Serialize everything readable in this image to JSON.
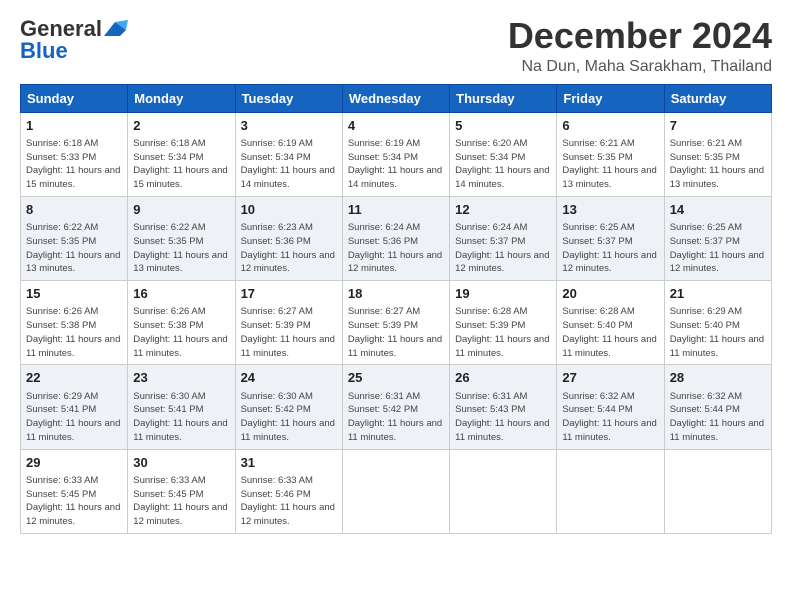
{
  "header": {
    "logo_general": "General",
    "logo_blue": "Blue",
    "month_title": "December 2024",
    "location": "Na Dun, Maha Sarakham, Thailand"
  },
  "weekdays": [
    "Sunday",
    "Monday",
    "Tuesday",
    "Wednesday",
    "Thursday",
    "Friday",
    "Saturday"
  ],
  "weeks": [
    [
      {
        "day": "1",
        "sunrise": "6:18 AM",
        "sunset": "5:33 PM",
        "daylight": "11 hours and 15 minutes."
      },
      {
        "day": "2",
        "sunrise": "6:18 AM",
        "sunset": "5:34 PM",
        "daylight": "11 hours and 15 minutes."
      },
      {
        "day": "3",
        "sunrise": "6:19 AM",
        "sunset": "5:34 PM",
        "daylight": "11 hours and 14 minutes."
      },
      {
        "day": "4",
        "sunrise": "6:19 AM",
        "sunset": "5:34 PM",
        "daylight": "11 hours and 14 minutes."
      },
      {
        "day": "5",
        "sunrise": "6:20 AM",
        "sunset": "5:34 PM",
        "daylight": "11 hours and 14 minutes."
      },
      {
        "day": "6",
        "sunrise": "6:21 AM",
        "sunset": "5:35 PM",
        "daylight": "11 hours and 13 minutes."
      },
      {
        "day": "7",
        "sunrise": "6:21 AM",
        "sunset": "5:35 PM",
        "daylight": "11 hours and 13 minutes."
      }
    ],
    [
      {
        "day": "8",
        "sunrise": "6:22 AM",
        "sunset": "5:35 PM",
        "daylight": "11 hours and 13 minutes."
      },
      {
        "day": "9",
        "sunrise": "6:22 AM",
        "sunset": "5:35 PM",
        "daylight": "11 hours and 13 minutes."
      },
      {
        "day": "10",
        "sunrise": "6:23 AM",
        "sunset": "5:36 PM",
        "daylight": "11 hours and 12 minutes."
      },
      {
        "day": "11",
        "sunrise": "6:24 AM",
        "sunset": "5:36 PM",
        "daylight": "11 hours and 12 minutes."
      },
      {
        "day": "12",
        "sunrise": "6:24 AM",
        "sunset": "5:37 PM",
        "daylight": "11 hours and 12 minutes."
      },
      {
        "day": "13",
        "sunrise": "6:25 AM",
        "sunset": "5:37 PM",
        "daylight": "11 hours and 12 minutes."
      },
      {
        "day": "14",
        "sunrise": "6:25 AM",
        "sunset": "5:37 PM",
        "daylight": "11 hours and 12 minutes."
      }
    ],
    [
      {
        "day": "15",
        "sunrise": "6:26 AM",
        "sunset": "5:38 PM",
        "daylight": "11 hours and 11 minutes."
      },
      {
        "day": "16",
        "sunrise": "6:26 AM",
        "sunset": "5:38 PM",
        "daylight": "11 hours and 11 minutes."
      },
      {
        "day": "17",
        "sunrise": "6:27 AM",
        "sunset": "5:39 PM",
        "daylight": "11 hours and 11 minutes."
      },
      {
        "day": "18",
        "sunrise": "6:27 AM",
        "sunset": "5:39 PM",
        "daylight": "11 hours and 11 minutes."
      },
      {
        "day": "19",
        "sunrise": "6:28 AM",
        "sunset": "5:39 PM",
        "daylight": "11 hours and 11 minutes."
      },
      {
        "day": "20",
        "sunrise": "6:28 AM",
        "sunset": "5:40 PM",
        "daylight": "11 hours and 11 minutes."
      },
      {
        "day": "21",
        "sunrise": "6:29 AM",
        "sunset": "5:40 PM",
        "daylight": "11 hours and 11 minutes."
      }
    ],
    [
      {
        "day": "22",
        "sunrise": "6:29 AM",
        "sunset": "5:41 PM",
        "daylight": "11 hours and 11 minutes."
      },
      {
        "day": "23",
        "sunrise": "6:30 AM",
        "sunset": "5:41 PM",
        "daylight": "11 hours and 11 minutes."
      },
      {
        "day": "24",
        "sunrise": "6:30 AM",
        "sunset": "5:42 PM",
        "daylight": "11 hours and 11 minutes."
      },
      {
        "day": "25",
        "sunrise": "6:31 AM",
        "sunset": "5:42 PM",
        "daylight": "11 hours and 11 minutes."
      },
      {
        "day": "26",
        "sunrise": "6:31 AM",
        "sunset": "5:43 PM",
        "daylight": "11 hours and 11 minutes."
      },
      {
        "day": "27",
        "sunrise": "6:32 AM",
        "sunset": "5:44 PM",
        "daylight": "11 hours and 11 minutes."
      },
      {
        "day": "28",
        "sunrise": "6:32 AM",
        "sunset": "5:44 PM",
        "daylight": "11 hours and 11 minutes."
      }
    ],
    [
      {
        "day": "29",
        "sunrise": "6:33 AM",
        "sunset": "5:45 PM",
        "daylight": "11 hours and 12 minutes."
      },
      {
        "day": "30",
        "sunrise": "6:33 AM",
        "sunset": "5:45 PM",
        "daylight": "11 hours and 12 minutes."
      },
      {
        "day": "31",
        "sunrise": "6:33 AM",
        "sunset": "5:46 PM",
        "daylight": "11 hours and 12 minutes."
      },
      null,
      null,
      null,
      null
    ]
  ],
  "labels": {
    "sunrise": "Sunrise: ",
    "sunset": "Sunset: ",
    "daylight": "Daylight: "
  }
}
